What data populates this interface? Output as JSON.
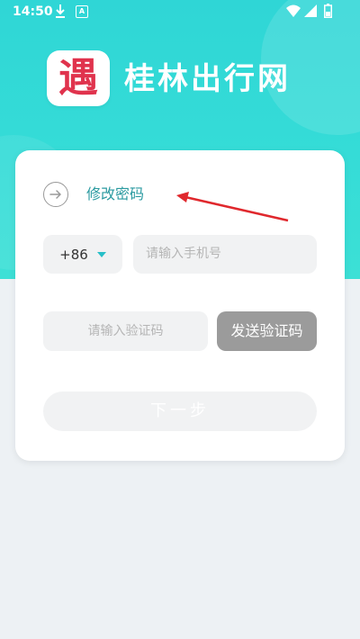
{
  "status_bar": {
    "time": "14:50",
    "a_icon_label": "A"
  },
  "app": {
    "logo_glyph": "遇",
    "title": "桂林出行网"
  },
  "form": {
    "title": "修改密码",
    "country_code": "+86",
    "phone_placeholder": "请输入手机号",
    "code_placeholder": "请输入验证码",
    "send_code_label": "发送验证码",
    "next_label": "下一步"
  },
  "colors": {
    "brand": "#2fd6d6",
    "title_accent": "#2a9aa0",
    "annotation_arrow": "#e0282d",
    "send_button_bg": "#9b9b9b"
  },
  "icons": {
    "back": "arrow-right-circle-icon",
    "dropdown": "caret-down-icon",
    "download": "download-icon",
    "wifi": "wifi-icon",
    "signal": "signal-icon",
    "battery": "battery-icon"
  }
}
